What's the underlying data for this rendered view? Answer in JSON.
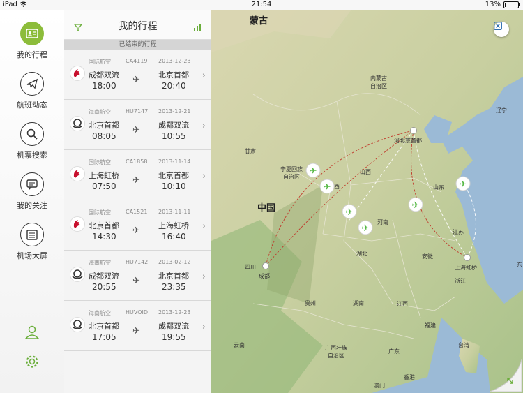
{
  "status_bar": {
    "device": "iPad",
    "time": "21:54",
    "battery": "13%",
    "battery_level": 0.13
  },
  "nav": {
    "items": [
      {
        "label": "我的行程",
        "icon": "itinerary-icon",
        "active": true
      },
      {
        "label": "航班动态",
        "icon": "plane-icon",
        "active": false
      },
      {
        "label": "机票搜索",
        "icon": "search-icon",
        "active": false
      },
      {
        "label": "我的关注",
        "icon": "message-icon",
        "active": false
      },
      {
        "label": "机场大屏",
        "icon": "board-icon",
        "active": false
      }
    ],
    "bottom": {
      "profile_icon": "user-icon",
      "settings_icon": "gear-icon"
    }
  },
  "panel": {
    "title": "我的行程",
    "section": "已结束的行程",
    "filter_icon": "filter-icon",
    "stats_icon": "bar-chart-icon"
  },
  "trips": [
    {
      "airline": "国际航空",
      "flight": "CA4119",
      "date": "2013-12-23",
      "from": "成都双流",
      "to": "北京首都",
      "dep": "18:00",
      "arr": "20:40",
      "logo": "air-china-logo"
    },
    {
      "airline": "海南航空",
      "flight": "HU7147",
      "date": "2013-12-21",
      "from": "北京首都",
      "to": "成都双流",
      "dep": "08:05",
      "arr": "10:55",
      "logo": "hainan-logo"
    },
    {
      "airline": "国际航空",
      "flight": "CA1858",
      "date": "2013-11-14",
      "from": "上海虹桥",
      "to": "北京首都",
      "dep": "07:50",
      "arr": "10:10",
      "logo": "air-china-logo"
    },
    {
      "airline": "国际航空",
      "flight": "CA1521",
      "date": "2013-11-11",
      "from": "北京首都",
      "to": "上海虹桥",
      "dep": "14:30",
      "arr": "16:40",
      "logo": "air-china-logo"
    },
    {
      "airline": "海南航空",
      "flight": "HU7142",
      "date": "2013-02-12",
      "from": "成都双流",
      "to": "北京首都",
      "dep": "20:55",
      "arr": "23:35",
      "logo": "hainan-logo"
    },
    {
      "airline": "海南航空",
      "flight": "HUVOID",
      "date": "2013-12-23",
      "from": "北京首都",
      "to": "成都双流",
      "dep": "17:05",
      "arr": "19:55",
      "logo": "hainan-logo"
    }
  ],
  "map": {
    "labels": {
      "mongolia": "蒙古",
      "inner_mongolia": "内蒙古\n自治区",
      "liaoning": "辽宁",
      "gansu": "甘肃",
      "ningxia": "宁夏回族\n自治区",
      "shanxi": "山西",
      "shaanxi": "西",
      "hebei_beijing": "河北京首都",
      "shandong": "山东",
      "china": "中国",
      "henan": "河南",
      "jiangsu": "江苏",
      "hubei": "湖北",
      "anhui": "安徽",
      "shanghai": "上海虹桥",
      "zhejiang": "浙江",
      "sichuan": "四川",
      "chengdu": "成都",
      "guizhou": "贵州",
      "hunan": "湖南",
      "jiangxi": "江西",
      "fujian": "福建",
      "yunnan": "云南",
      "guangxi": "广西壮族\n自治区",
      "guangdong": "广东",
      "taiwan": "台湾",
      "hongkong": "香港",
      "macau": "澳门",
      "east_edge": "东"
    },
    "close_icon": "close-map-icon",
    "expand_icon": "expand-icon",
    "colors": {
      "land": "#c9cfa0",
      "sea": "#9bbad6",
      "route": "#c0392b",
      "plane": "#58b947"
    }
  }
}
